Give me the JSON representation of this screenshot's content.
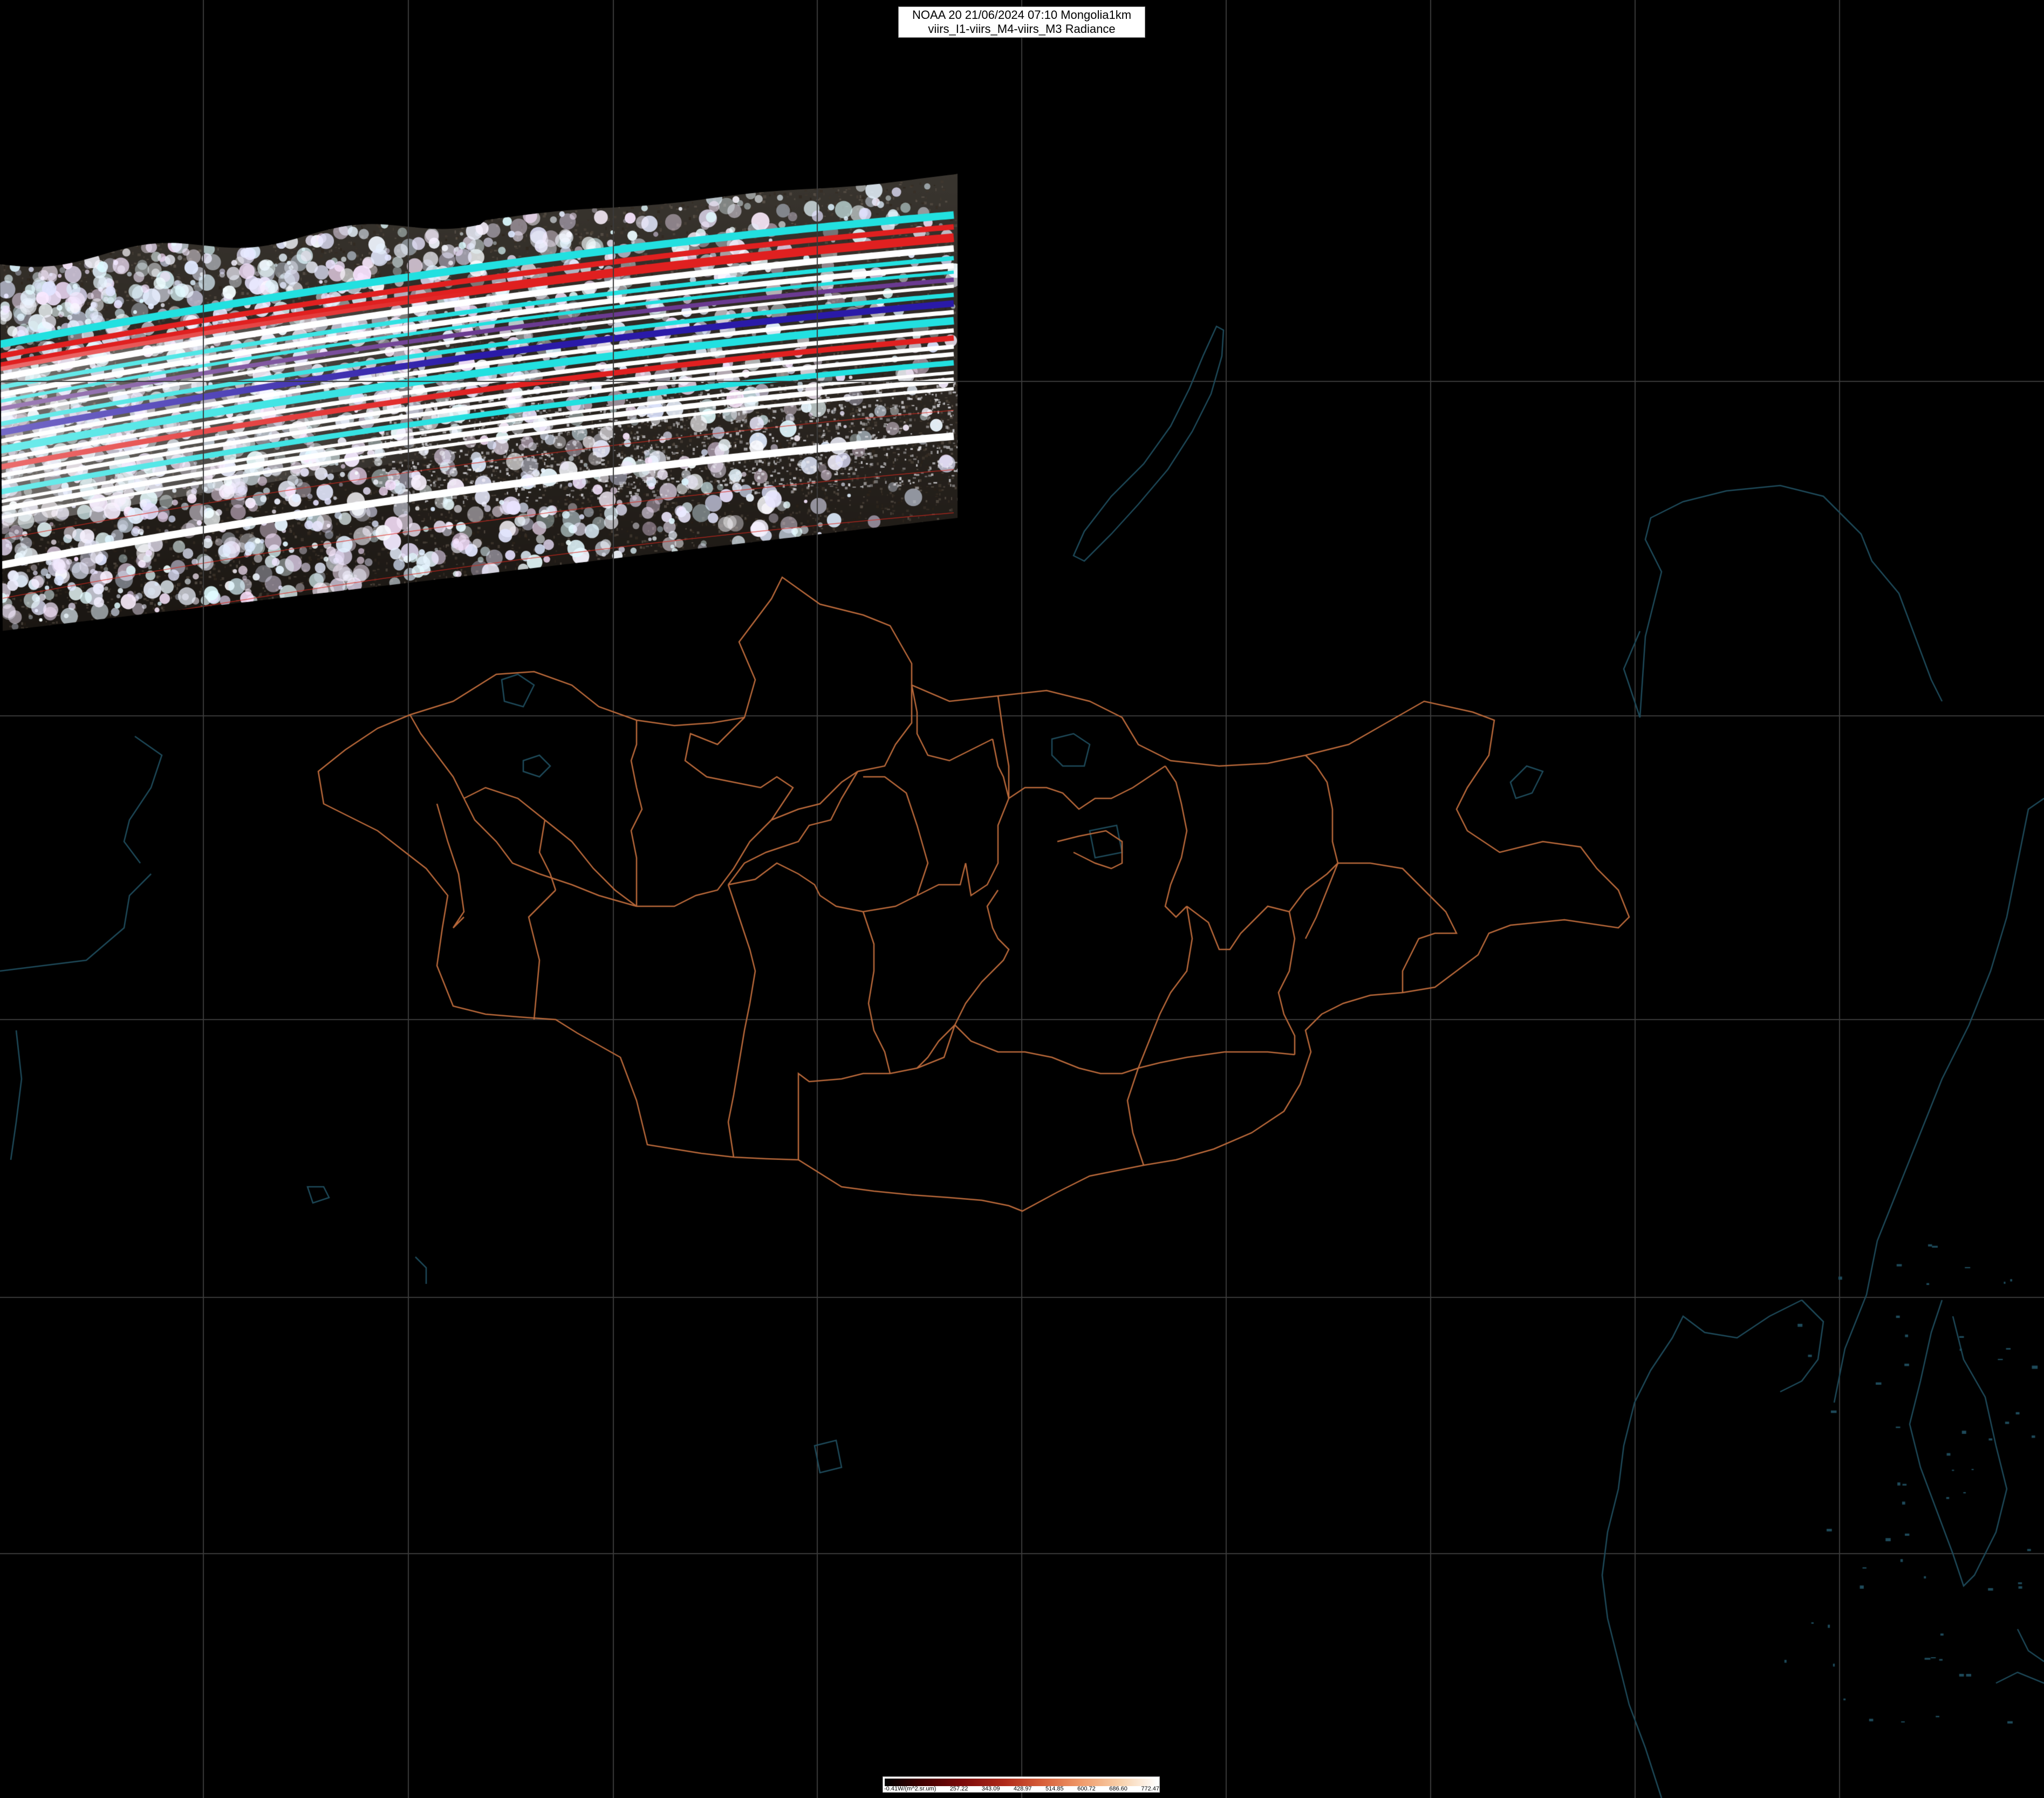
{
  "title": {
    "line1": "NOAA 20 21/06/2024 07:10 Mongolia1km",
    "line2": "viirs_I1-viirs_M4-viirs_M3 Radiance"
  },
  "colorbar": {
    "labels": [
      "-0.41W/(m^2.sr.um)",
      "257.22",
      "343.09",
      "428.97",
      "514.85",
      "600.72",
      "686.60",
      "772.47"
    ]
  },
  "colors": {
    "background": "#000000",
    "graticule": "#3a3a3a",
    "admin_borders": "#b8683a",
    "coastlines": "#1e4a5a",
    "stripe_cyan": "#22e0e0",
    "stripe_red": "#e02020",
    "stripe_blue": "#2a1aa8",
    "stripe_white": "#ffffff"
  },
  "icons": {
    "map": "satellite-swath-map"
  }
}
